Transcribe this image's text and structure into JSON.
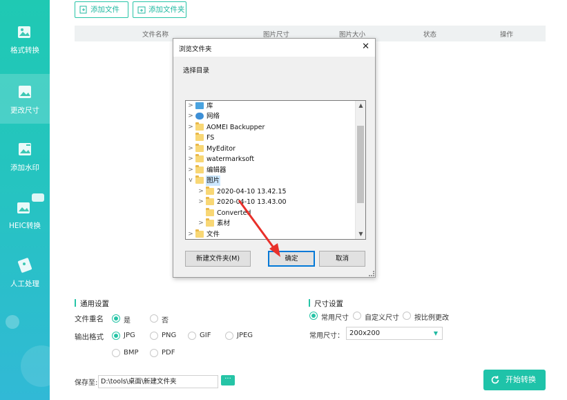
{
  "sidebar": {
    "items": [
      {
        "label": "格式转换",
        "icon": "image-convert-icon"
      },
      {
        "label": "更改尺寸",
        "icon": "image-resize-icon"
      },
      {
        "label": "添加水印",
        "icon": "watermark-icon"
      },
      {
        "label": "HEIC转换",
        "icon": "heic-icon"
      },
      {
        "label": "人工处理",
        "icon": "manual-process-icon"
      }
    ]
  },
  "toolbar": {
    "add_file": "添加文件",
    "add_folder": "添加文件夹"
  },
  "table": {
    "columns": [
      "文件名称",
      "图片尺寸",
      "图片大小",
      "状态",
      "操作"
    ]
  },
  "dialog": {
    "title": "浏览文件夹",
    "close": "✕",
    "subtitle": "选择目录",
    "tree": [
      {
        "label": "库",
        "icon": "library-icon",
        "arrow": ">"
      },
      {
        "label": "网络",
        "icon": "network-icon",
        "arrow": ">"
      },
      {
        "label": "AOMEI Backupper",
        "icon": "folder-icon",
        "arrow": ">"
      },
      {
        "label": "FS",
        "icon": "folder-icon",
        "arrow": ""
      },
      {
        "label": "MyEditor",
        "icon": "folder-icon",
        "arrow": ">"
      },
      {
        "label": "watermarksoft",
        "icon": "folder-icon",
        "arrow": ">"
      },
      {
        "label": "编辑器",
        "icon": "folder-icon",
        "arrow": ">"
      },
      {
        "label": "图片",
        "icon": "folder-icon",
        "arrow": "v",
        "selected": true
      },
      {
        "label": "2020-04-10 13.42.15",
        "icon": "folder-icon",
        "arrow": ">"
      },
      {
        "label": "2020-04-10 13.43.00",
        "icon": "folder-icon",
        "arrow": ">"
      },
      {
        "label": "Converted",
        "icon": "folder-icon",
        "arrow": ""
      },
      {
        "label": "素材",
        "icon": "folder-icon",
        "arrow": ">"
      },
      {
        "label": "文件",
        "icon": "folder-icon",
        "arrow": ">"
      }
    ],
    "new_folder": "新建文件夹(M)",
    "ok": "确定",
    "cancel": "取消"
  },
  "settings": {
    "general_title": "通用设置",
    "rename_label": "文件重名",
    "rename_yes": "是",
    "rename_no": "否",
    "format_label": "输出格式",
    "formats": [
      "JPG",
      "PNG",
      "GIF",
      "JPEG",
      "BMP",
      "PDF"
    ],
    "selected_format": "JPG",
    "size_title": "尺寸设置",
    "size_options": [
      "常用尺寸",
      "自定义尺寸",
      "按比例更改"
    ],
    "common_size_label": "常用尺寸：",
    "common_size_value": "200x200",
    "save_label": "保存至:",
    "save_path": "D:\\tools\\桌面\\新建文件夹",
    "browse": "···",
    "start": "开始转换"
  },
  "accent_color": "#25c4a6"
}
